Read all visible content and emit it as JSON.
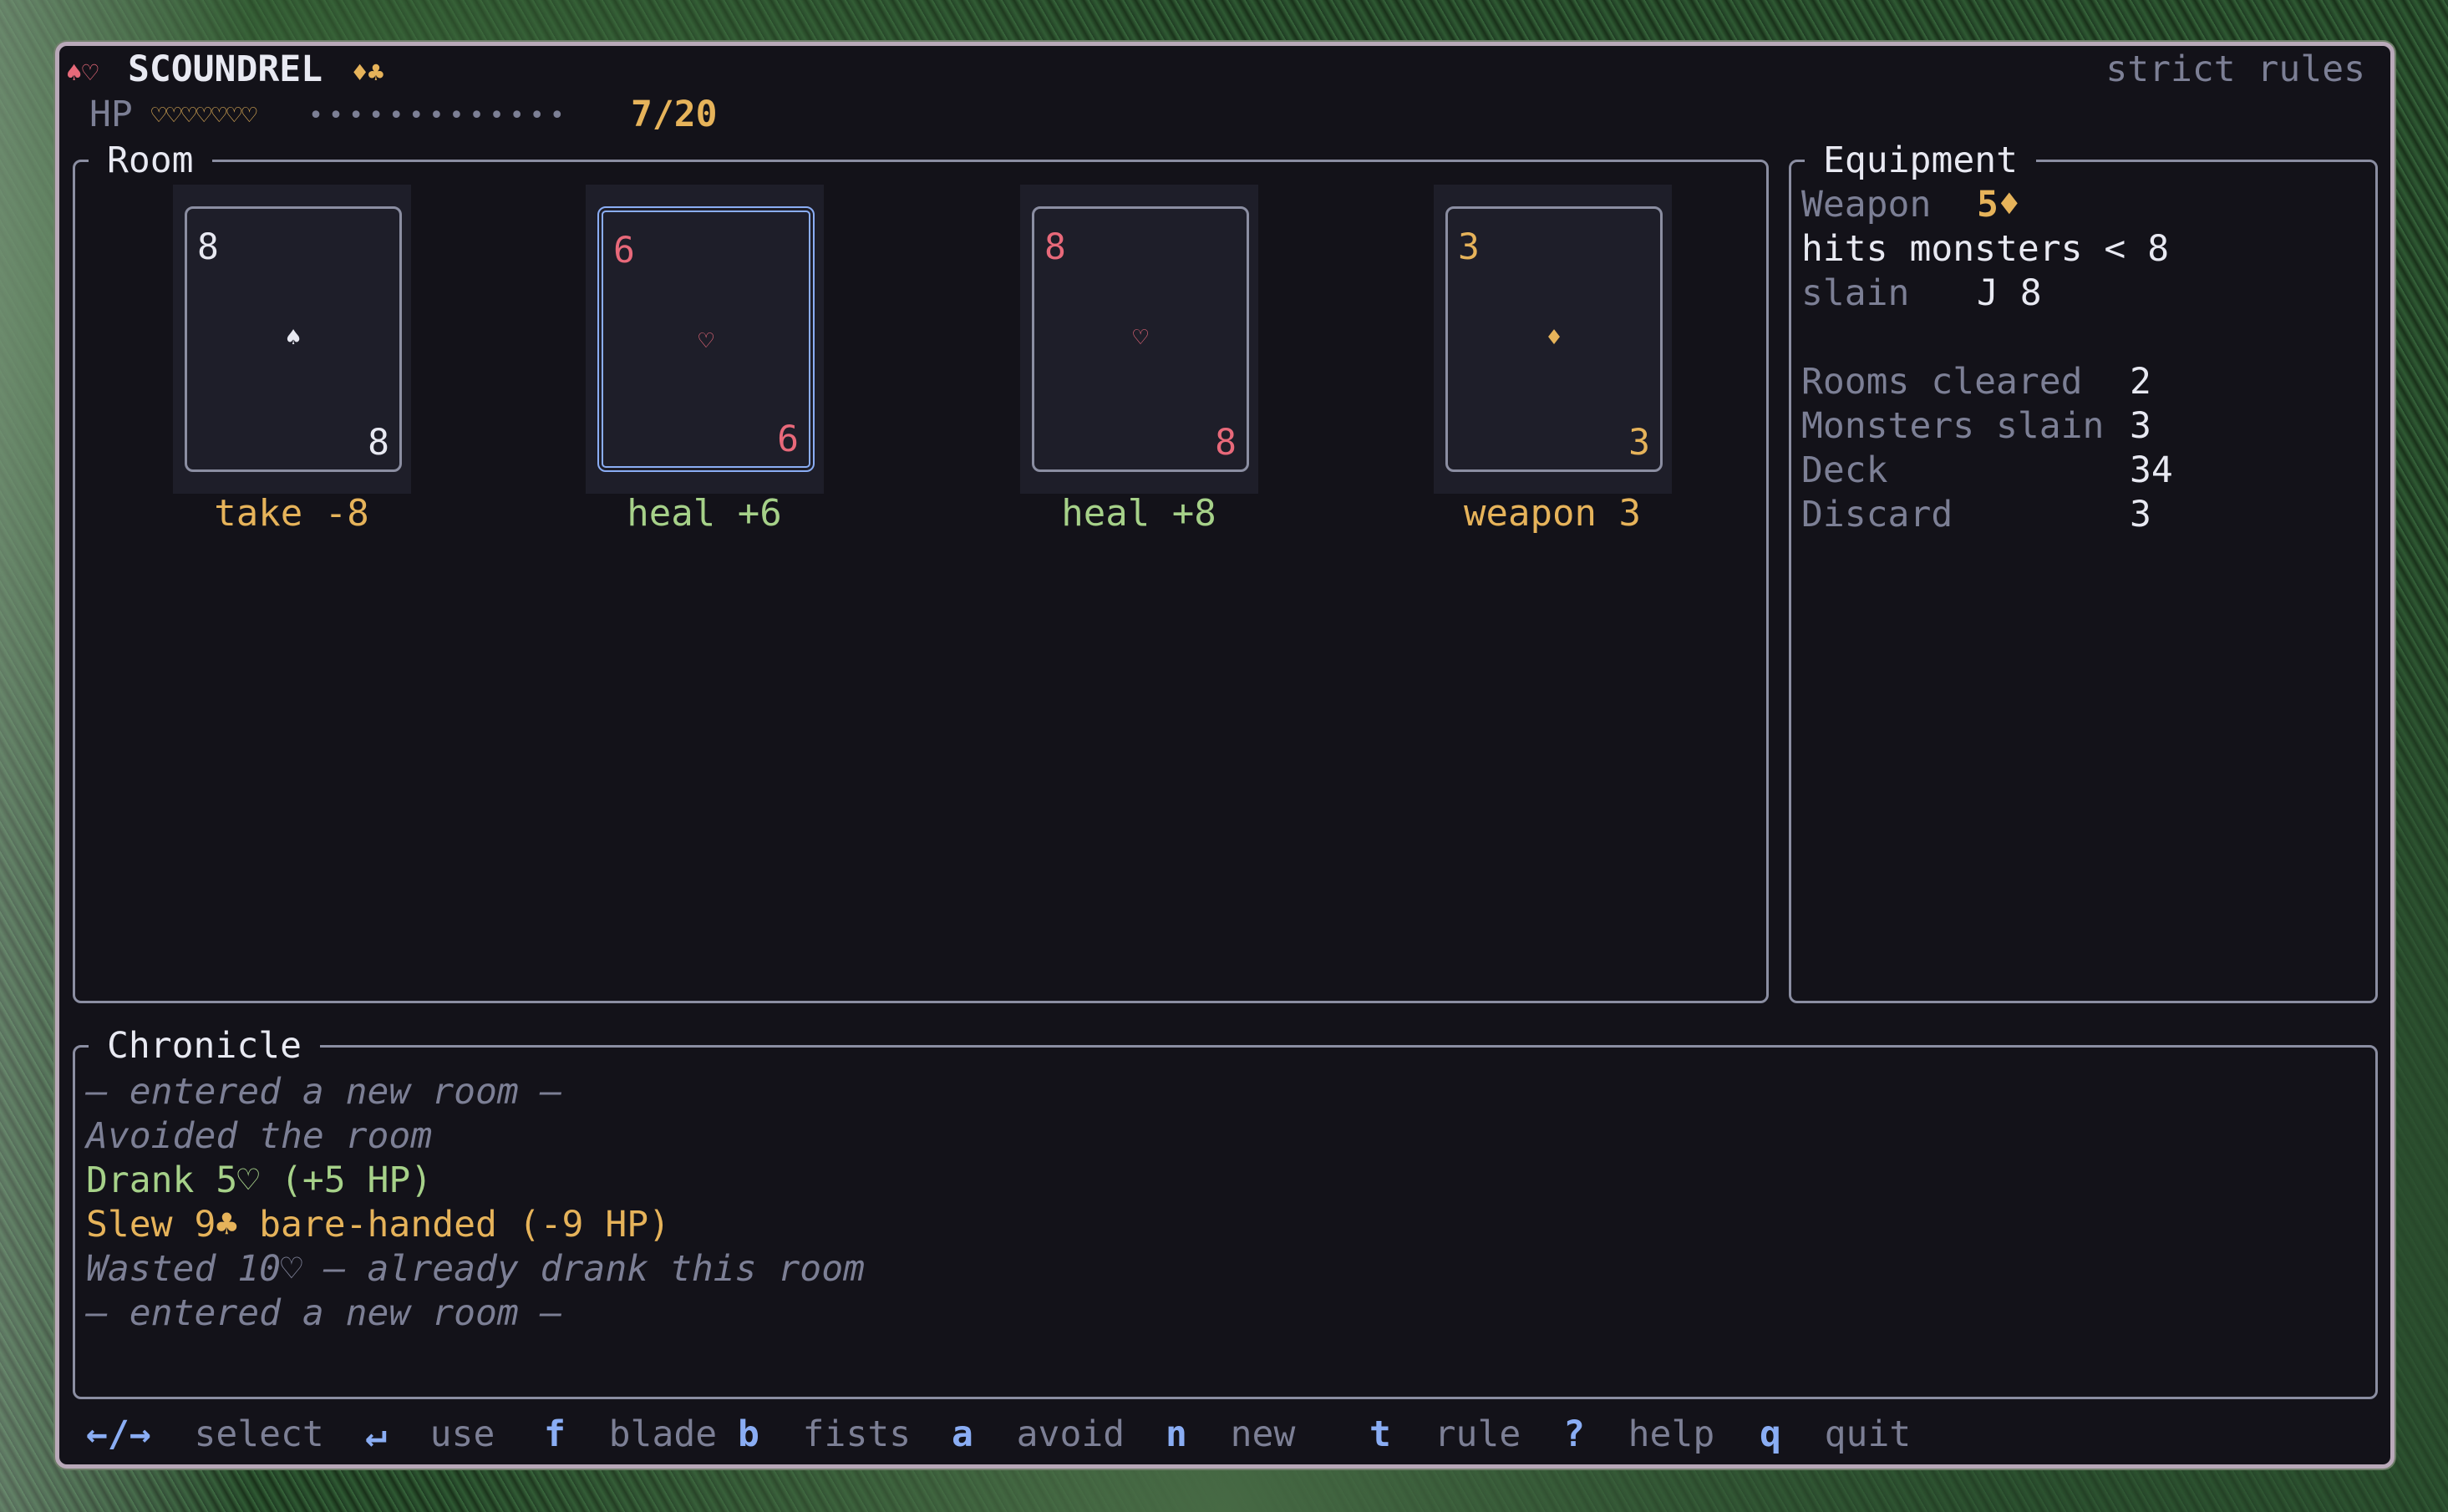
{
  "header": {
    "title_suits_left": "♠♡",
    "title": "SCOUNDREL",
    "title_suits_right": "♦♣",
    "mode": "strict rules",
    "hp_label": "HP",
    "hp_hearts": "♡♡♡♡♡♡♡",
    "hp_dots": "•••••••••••••",
    "hp_value": "7/20",
    "hp_current": 7,
    "hp_max": 20
  },
  "room": {
    "title": "Room",
    "cards": [
      {
        "rank": "8",
        "suit": "♠",
        "color": "#e8e9f2",
        "action": "take -8",
        "selected": false
      },
      {
        "rank": "6",
        "suit": "♡",
        "color": "#e8697a",
        "action": "heal +6",
        "selected": true
      },
      {
        "rank": "8",
        "suit": "♡",
        "color": "#e8697a",
        "action": "heal +8",
        "selected": false
      },
      {
        "rank": "3",
        "suit": "♦",
        "color": "#e6b35a",
        "action": "weapon 3",
        "selected": false
      }
    ]
  },
  "equipment": {
    "title": "Equipment",
    "weapon_label": "Weapon",
    "weapon_value": "5♦",
    "hits_text": "hits monsters < 8",
    "slain_label": "slain",
    "slain_value": "J 8",
    "stats": [
      {
        "label": "Rooms cleared",
        "value": "2"
      },
      {
        "label": "Monsters slain",
        "value": "3"
      },
      {
        "label": "Deck",
        "value": "34"
      },
      {
        "label": "Discard",
        "value": "3"
      }
    ]
  },
  "chronicle": {
    "title": "Chronicle",
    "entries": [
      "— entered a new room —",
      "Avoided the room",
      "Drank 5♡ (+5 HP)",
      "Slew 9♣ bare-handed (-9 HP)",
      "Wasted 10♡ — already drank this room",
      "— entered a new room —"
    ]
  },
  "keys": [
    {
      "key": "←/→",
      "label": "select"
    },
    {
      "key": "↵",
      "label": "use"
    },
    {
      "key": "f",
      "label": "blade"
    },
    {
      "key": "b",
      "label": "fists"
    },
    {
      "key": "a",
      "label": "avoid"
    },
    {
      "key": "n",
      "label": "new"
    },
    {
      "key": "t",
      "label": "rule"
    },
    {
      "key": "?",
      "label": "help"
    },
    {
      "key": "q",
      "label": "quit"
    }
  ],
  "colors": {
    "accent": "#8aadf4",
    "gold": "#e6b35a",
    "heal": "#a6d189",
    "heart": "#e8697a",
    "background": "#131219"
  }
}
